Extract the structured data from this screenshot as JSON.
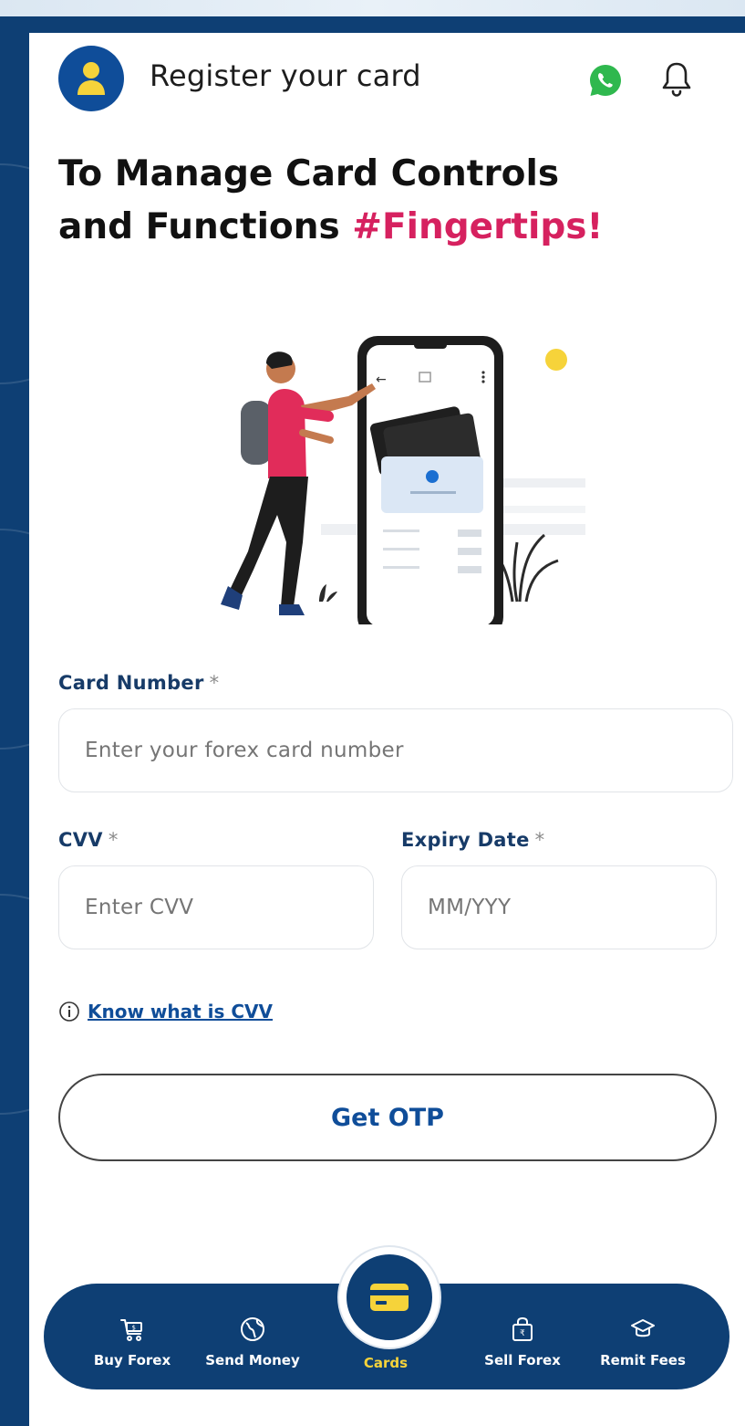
{
  "header": {
    "title": "Register your card",
    "icons": [
      "user-avatar-icon",
      "whatsapp-icon",
      "bell-icon"
    ]
  },
  "headline": {
    "line1": "To Manage Card Controls",
    "line2_prefix": "and Functions ",
    "line2_highlight": "#Fingertips!"
  },
  "form": {
    "card_number": {
      "label": "Card Number",
      "required_mark": "*",
      "placeholder": "Enter your forex card number"
    },
    "cvv": {
      "label": "CVV",
      "required_mark": "*",
      "placeholder": "Enter CVV"
    },
    "expiry": {
      "label": "Expiry Date",
      "required_mark": "*",
      "placeholder": "MM/YYY"
    },
    "cvv_help": "Know what is CVV",
    "submit_label": "Get OTP"
  },
  "bottom_nav": {
    "items": [
      {
        "label": "Buy Forex",
        "icon": "cart-icon"
      },
      {
        "label": "Send Money",
        "icon": "globe-icon"
      },
      {
        "label": "Cards",
        "icon": "card-icon",
        "active": true
      },
      {
        "label": "Sell Forex",
        "icon": "bag-icon"
      },
      {
        "label": "Remit Fees",
        "icon": "graduation-cap-icon"
      }
    ]
  },
  "colors": {
    "brand_blue": "#0e3f74",
    "link_blue": "#0f4d99",
    "highlight_pink": "#d6215f",
    "active_yellow": "#f6d33a"
  }
}
